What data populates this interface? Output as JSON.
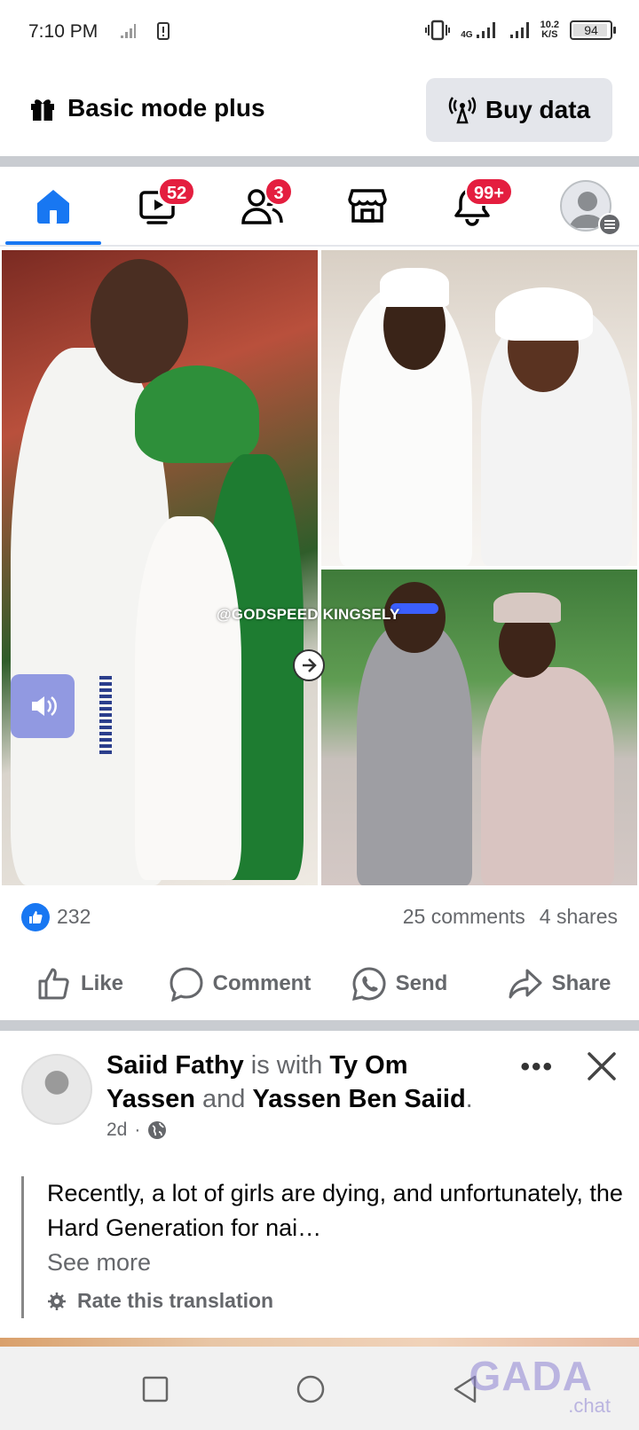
{
  "status_bar": {
    "time": "7:10 PM",
    "network_type": "4G",
    "net_speed_value": "10.2",
    "net_speed_unit": "K/S",
    "battery": "94",
    "battery_level": 0.94
  },
  "basic_mode": {
    "title": "Basic mode plus",
    "buy_data_label": "Buy data",
    "gift_icon": "gift-icon",
    "antenna_icon": "antenna-icon"
  },
  "nav_tabs": [
    {
      "name": "home",
      "icon": "home-icon",
      "badge": "",
      "active": true
    },
    {
      "name": "video",
      "icon": "video-icon",
      "badge": "52"
    },
    {
      "name": "friends",
      "icon": "friends-icon",
      "badge": "3"
    },
    {
      "name": "marketplace",
      "icon": "marketplace-icon",
      "badge": ""
    },
    {
      "name": "notifications",
      "icon": "bell-icon",
      "badge": "99+"
    },
    {
      "name": "profile",
      "icon": "avatar-icon",
      "badge": ""
    }
  ],
  "post": {
    "image_watermark": "@GODSPEED KINGSELY",
    "like_count": "232",
    "comments": "25 comments",
    "shares": "4 shares",
    "actions": {
      "like": "Like",
      "comment": "Comment",
      "send": "Send",
      "share": "Share"
    }
  },
  "next_post": {
    "author": "Saiid Fathy",
    "with_text": "is with",
    "tagged_1": "Ty Om Yassen",
    "and_text": "and",
    "tagged_2": "Yassen Ben Saiid",
    "period": ".",
    "time": "2d",
    "dot": "·",
    "text": "Recently, a lot of girls are dying, and unfortunately, the Hard Generation for nai…",
    "see_more": "See more",
    "rate_translation": "Rate this translation"
  },
  "watermark": {
    "brand": "GADA",
    "suffix": ".chat"
  },
  "colors": {
    "accent": "#1877f2",
    "badge": "#e41e3f",
    "muted_text": "#65676b"
  }
}
